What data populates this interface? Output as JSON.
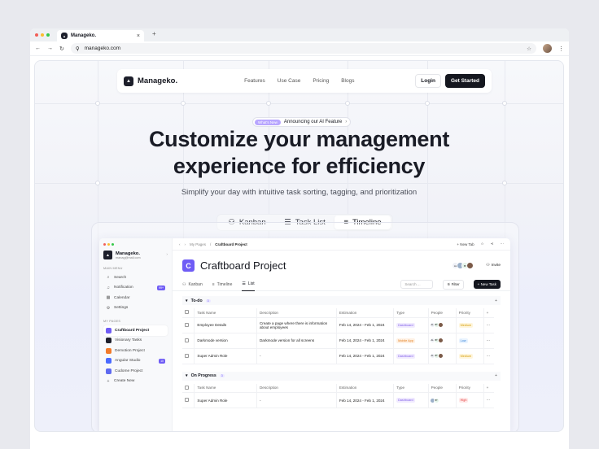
{
  "browser": {
    "tab_title": "Manageko.",
    "tab_close": "×",
    "new_tab": "+",
    "url": "manageko.com",
    "colors": {
      "red": "#f25f58",
      "yellow": "#fbbd2e",
      "green": "#35c84a"
    }
  },
  "nav": {
    "brand": "Manageko.",
    "links": [
      "Features",
      "Use Case",
      "Pricing",
      "Blogs"
    ],
    "login": "Login",
    "get_started": "Get Started"
  },
  "hero": {
    "badge": "What's New",
    "announcement": "Announcing our AI Feature",
    "headline_1": "Customize your management",
    "headline_2": "experience for efficiency",
    "subheadline": "Simplify your day with intuitive task sorting, tagging, and prioritization"
  },
  "views": [
    {
      "label": "Kanban",
      "icon": "kanban-icon"
    },
    {
      "label": "Task List",
      "icon": "list-icon"
    },
    {
      "label": "Timeline",
      "icon": "timeline-icon",
      "active": true
    }
  ],
  "app": {
    "workspace": {
      "name": "Manageko.",
      "email": "manag@mail.com"
    },
    "main_menu_label": "MAIN MENU",
    "main_menu": [
      {
        "label": "Search",
        "icon": "search-icon"
      },
      {
        "label": "Notification",
        "icon": "bell-icon",
        "count": "99+"
      },
      {
        "label": "Calendar",
        "icon": "calendar-icon"
      },
      {
        "label": "Settings",
        "icon": "gear-icon"
      }
    ],
    "my_pages_label": "MY PAGES",
    "pages": [
      {
        "label": "Craftboard Project",
        "color": "#6f5cf5",
        "active": true
      },
      {
        "label": "Visionary Tasks",
        "color": "#1d1f2b"
      },
      {
        "label": "Demotion Project",
        "color": "#f27b2b"
      },
      {
        "label": "Angular Studio",
        "color": "#4b6bff",
        "count": "10"
      },
      {
        "label": "Cudome Project",
        "color": "#5e6af0"
      }
    ],
    "create_new": "Create New",
    "breadcrumb_root": "My Pages",
    "breadcrumb_sep": "/",
    "breadcrumb_current": "Craftboard Project",
    "new_tab": "New Tab",
    "project_title": "Craftboard Project",
    "project_letter": "C",
    "people_initials": [
      "AL",
      "BT"
    ],
    "invite": "Invite",
    "tabs": [
      "Kanban",
      "Timeline",
      "List"
    ],
    "search_placeholder": "Search ...",
    "filter": "Filter",
    "new_task": "New Task",
    "columns": [
      "Task Name",
      "Description",
      "Estimation",
      "Type",
      "People",
      "Priority"
    ],
    "groups": [
      {
        "name": "To-do",
        "count": "3",
        "rows": [
          {
            "task": "Employee Details",
            "desc": "Create a page where there is information about employees",
            "est": "Feb 14, 2024 - Feb 1, 2024",
            "type": "Dashboard",
            "type_style": "purple",
            "priority": "Medium",
            "pri_style": "medium"
          },
          {
            "task": "Darkmode version",
            "desc": "Darkmode version for all screens",
            "est": "Feb 14, 2024 - Feb 1, 2024",
            "type": "Mobile App",
            "type_style": "orange",
            "priority": "Low",
            "pri_style": "low"
          },
          {
            "task": "Super Admin Role",
            "desc": "-",
            "est": "Feb 14, 2024 - Feb 1, 2024",
            "type": "Dashboard",
            "type_style": "purple",
            "priority": "Medium",
            "pri_style": "medium"
          }
        ]
      },
      {
        "name": "On Progress",
        "count": "3",
        "rows": [
          {
            "task": "Super Admin Role",
            "desc": "-",
            "est": "Feb 14, 2024 - Feb 1, 2024",
            "type": "Dashboard",
            "type_style": "purple",
            "priority": "High",
            "pri_style": "high"
          }
        ]
      }
    ]
  }
}
